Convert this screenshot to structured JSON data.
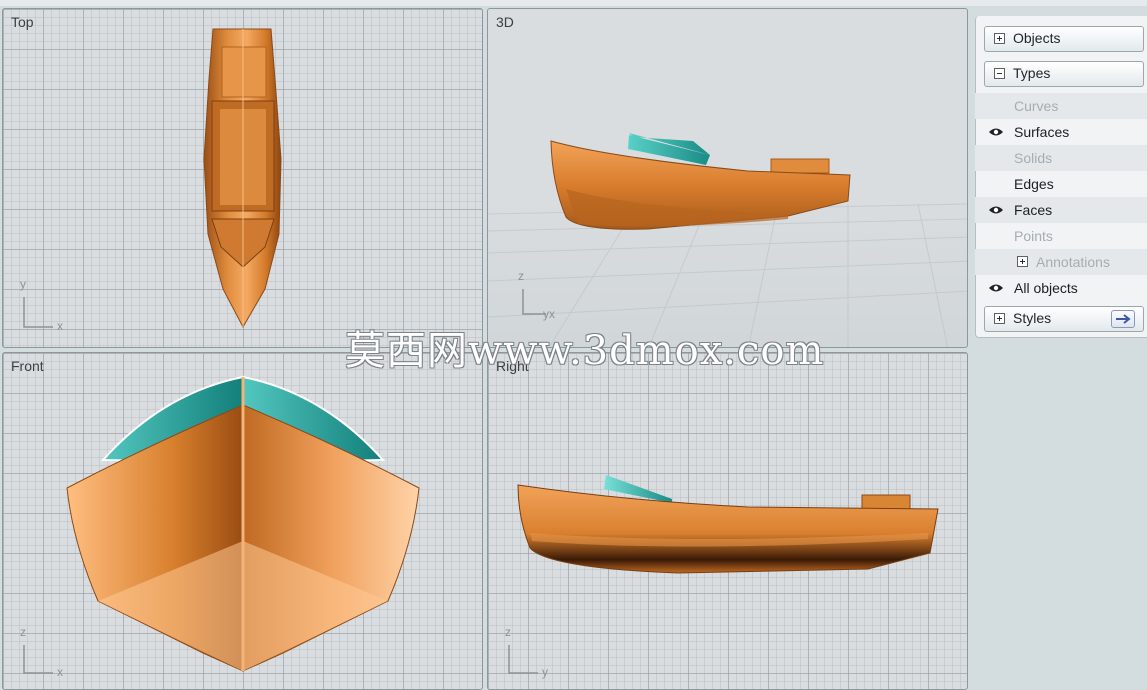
{
  "viewports": {
    "top": {
      "title": "Top",
      "axis_v": "y",
      "axis_h": "x"
    },
    "persp": {
      "title": "3D",
      "axis_v": "z",
      "axis_h": "yx"
    },
    "front": {
      "title": "Front",
      "axis_v": "z",
      "axis_h": "x"
    },
    "right": {
      "title": "Right",
      "axis_v": "z",
      "axis_h": "y"
    }
  },
  "panel": {
    "objects_label": "Objects",
    "types_label": "Types",
    "type_rows": [
      {
        "label": "Curves",
        "visible": false,
        "eye": false
      },
      {
        "label": "Surfaces",
        "visible": true,
        "eye": true
      },
      {
        "label": "Solids",
        "visible": false,
        "eye": false
      },
      {
        "label": "Edges",
        "visible": true,
        "eye": false
      },
      {
        "label": "Faces",
        "visible": true,
        "eye": true
      },
      {
        "label": "Points",
        "visible": false,
        "eye": false
      },
      {
        "label": "Annotations",
        "visible": false,
        "eye": false
      },
      {
        "label": "All objects",
        "visible": true,
        "eye": true
      }
    ],
    "styles_label": "Styles"
  },
  "watermark": "莫西网www.3dmox.com",
  "colors": {
    "hull": "#d77a2a",
    "canopy": "#2aa6a0",
    "background": "#d3dde0"
  }
}
